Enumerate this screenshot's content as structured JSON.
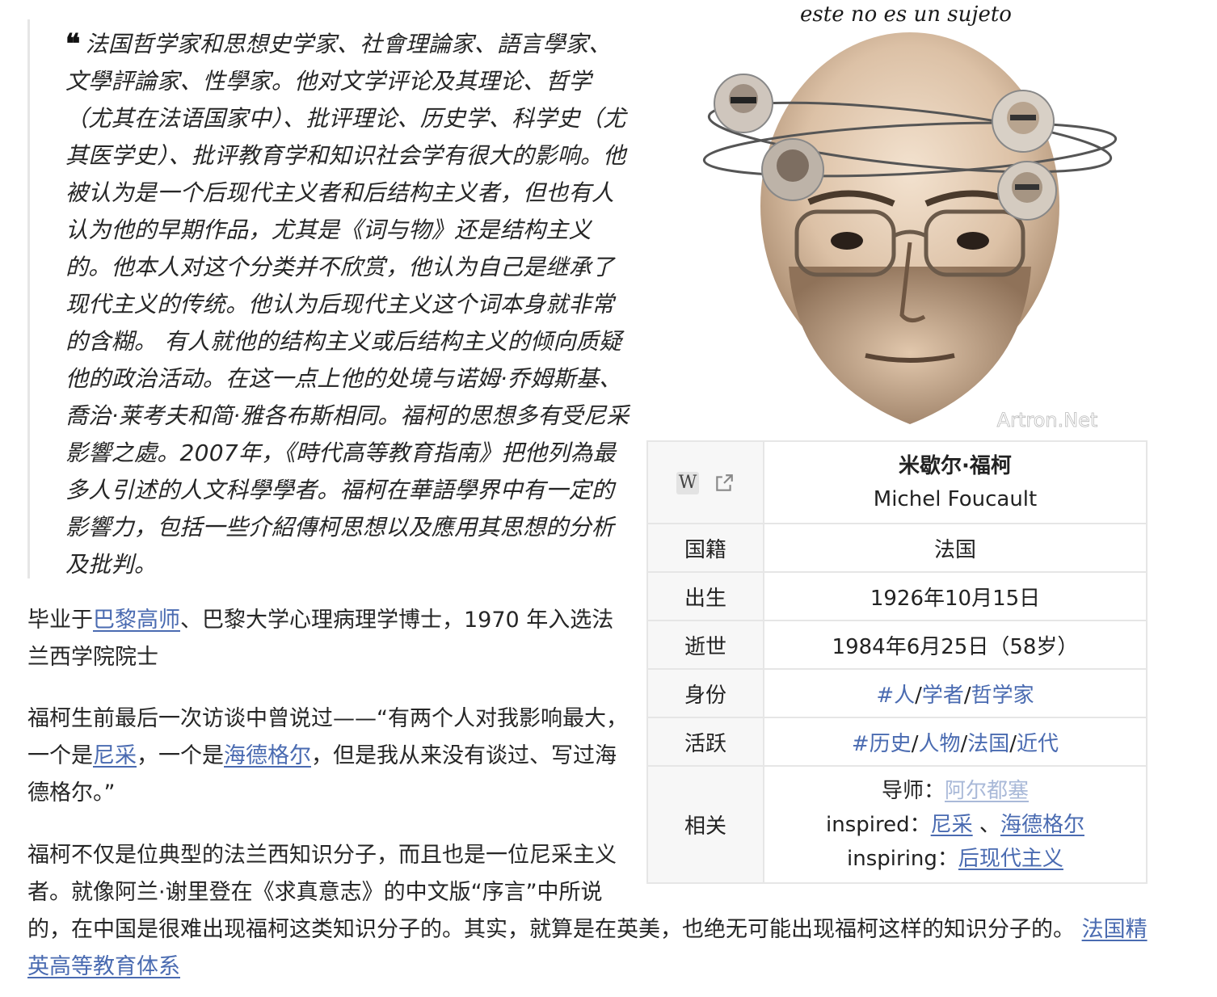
{
  "quote": {
    "mark": "❝",
    "text": "法国哲学家和思想史学家、社會理論家、語言學家、文學評論家、性學家。他对文学评论及其理论、哲学（尤其在法语国家中）、批评理论、历史学、科学史（尤其医学史）、批评教育学和知识社会学有很大的影响。他被认为是一个后现代主义者和后结构主义者，但也有人认为他的早期作品，尤其是《词与物》还是结构主义的。他本人对这个分类并不欣赏，他认为自己是继承了现代主义的传统。他认为后现代主义这个词本身就非常的含糊。 有人就他的结构主义或后结构主义的倾向质疑他的政治活动。在这一点上他的处境与诺姆·乔姆斯基、喬治·莱考夫和简·雅各布斯相同。福柯的思想多有受尼采影響之處。2007年，《時代高等教育指南》把他列為最多人引述的人文科學學者。福柯在華語學界中有一定的影響力，包括一些介紹傳柯思想以及應用其思想的分析及批判。"
  },
  "para1": {
    "pre": "毕业于",
    "link": "巴黎高师",
    "post": "、巴黎大学心理病理学博士，1970 年入选法兰西学院院士"
  },
  "para2": {
    "pre": "福柯生前最后一次访谈中曾说过——“有两个人对我影响最大，一个是",
    "link1": "尼采",
    "mid": "，一个是",
    "link2": "海德格尔",
    "post": "，但是我从来没有谈过、写过海德格尔。”"
  },
  "para3": {
    "text": "福柯不仅是位典型的法兰西知识分子，而且也是一位尼采主义者。就像阿兰·谢里登在《求真意志》的中文版“序言”中所说的，在中国是很难出现福柯这类知识分子的。其实，就算是在英美，也绝无可能出现福柯这样的知识分子的。 ",
    "link": "法国精英高等教育体系"
  },
  "portrait": {
    "caption": "este no es un sujeto",
    "watermark": "Artron.Net"
  },
  "infobox": {
    "wiki_icon": "W",
    "name_zh": "米歇尔·福柯",
    "name_en": "Michel Foucault",
    "rows": [
      {
        "key": "国籍",
        "value": "法国"
      },
      {
        "key": "出生",
        "value": "1926年10月15日"
      },
      {
        "key": "逝世",
        "value": "1984年6月25日（58岁）"
      }
    ],
    "identity": {
      "key": "身份",
      "tags": [
        "#人",
        "学者",
        "哲学家"
      ]
    },
    "active": {
      "key": "活跃",
      "tags": [
        "#历史",
        "人物",
        "法国",
        "近代"
      ]
    },
    "related": {
      "key": "相关",
      "mentor_label": "导师：",
      "mentor": "阿尔都塞",
      "inspired_label": "inspired：",
      "inspired": [
        "尼采",
        "海德格尔"
      ],
      "inspired_sep": " 、",
      "inspiring_label": "inspiring：",
      "inspiring": "后现代主义"
    },
    "tag_sep": "/"
  }
}
